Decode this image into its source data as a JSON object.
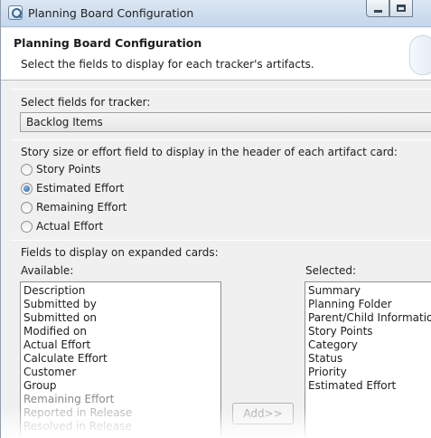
{
  "window": {
    "title": "Planning Board Configuration"
  },
  "header": {
    "title": "Planning Board Configuration",
    "description": "Select the fields to display for each tracker's artifacts."
  },
  "tracker_section": {
    "label": "Select fields for tracker:",
    "selected_value": "Backlog Items"
  },
  "story_size_section": {
    "label": "Story size or effort field to display in the header of each artifact card:",
    "options": [
      {
        "label": "Story Points",
        "checked": false
      },
      {
        "label": "Estimated Effort",
        "checked": true
      },
      {
        "label": "Remaining Effort",
        "checked": false
      },
      {
        "label": "Actual Effort",
        "checked": false
      }
    ]
  },
  "fields_section": {
    "label": "Fields to display on expanded cards:",
    "available_label": "Available:",
    "selected_label": "Selected:",
    "available_items": [
      "Description",
      "Submitted by",
      "Submitted on",
      "Modified on",
      "Actual Effort",
      "Calculate Effort",
      "Customer",
      "Group",
      "Remaining Effort",
      "Reported in Release",
      "Resolved in Release"
    ],
    "selected_items": [
      "Summary",
      "Planning Folder",
      "Parent/Child Information",
      "Story Points",
      "Category",
      "Status",
      "Priority",
      "Estimated Effort"
    ],
    "add_button_label": "Add>>"
  }
}
